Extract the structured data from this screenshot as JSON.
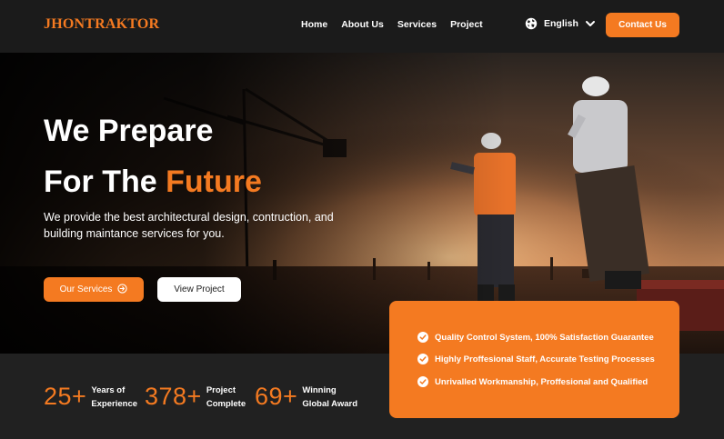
{
  "brand": {
    "logo": "JHONTRAKTOR",
    "accent": "#f47a21"
  },
  "nav": {
    "links": [
      "Home",
      "About Us",
      "Services",
      "Project"
    ],
    "language": "English",
    "contact_label": "Contact Us"
  },
  "hero": {
    "title_line1": "We Prepare",
    "title_line2_prefix": "For The ",
    "title_line2_accent": "Future",
    "subtitle": "We provide the best architectural design, contruction, and building maintance services for you.",
    "primary_button": "Our Services",
    "secondary_button": "View Project"
  },
  "stats": [
    {
      "value": "25+",
      "label_line1": "Years of",
      "label_line2": "Experience"
    },
    {
      "value": "378+",
      "label_line1": "Project",
      "label_line2": "Complete"
    },
    {
      "value": "69+",
      "label_line1": "Winning",
      "label_line2": "Global Award"
    }
  ],
  "features": [
    "Quality Control System, 100% Satisfaction Guarantee",
    "Highly Proffesional Staff, Accurate Testing Processes",
    "Unrivalled Workmanship, Proffesional and Qualified"
  ],
  "icons": [
    "globe-icon",
    "chevron-down-icon",
    "arrow-circle-icon",
    "check-circle-icon"
  ]
}
